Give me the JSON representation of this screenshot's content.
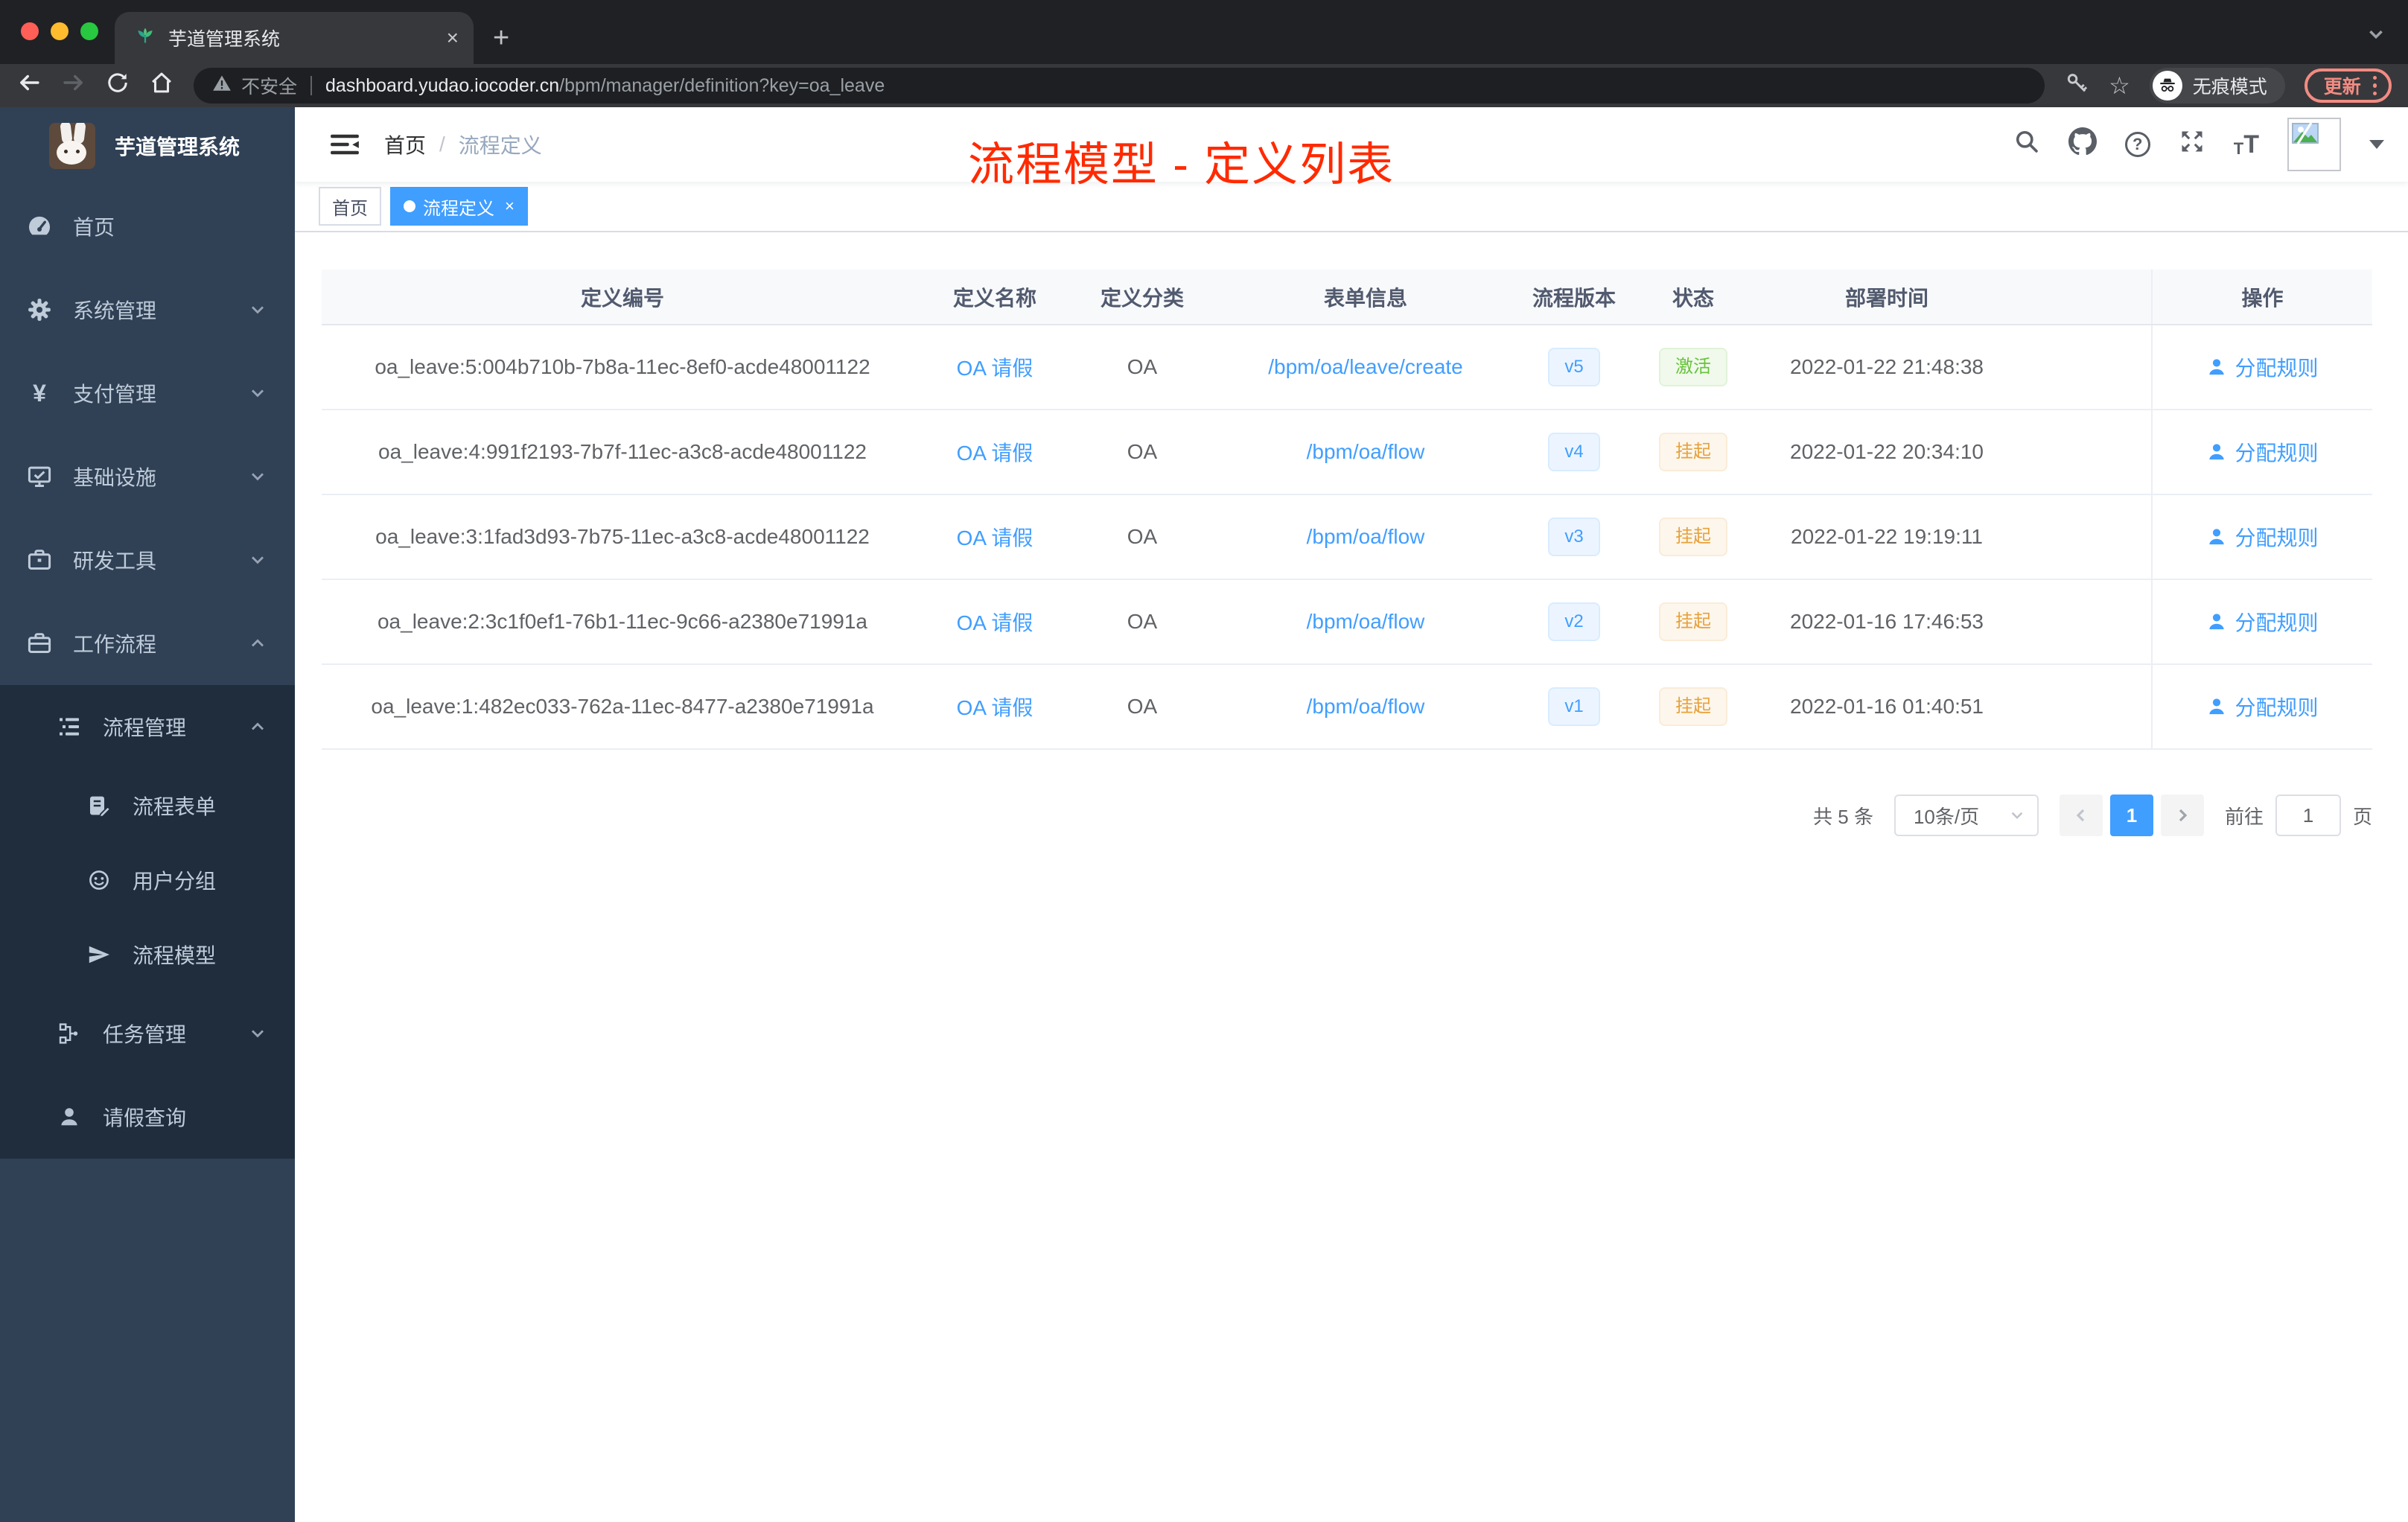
{
  "colors": {
    "accent": "#409eff",
    "success": "#67c23a",
    "warning": "#e6a23c",
    "annotation_red": "#ff2a00",
    "sidebar_bg": "#304156",
    "submenu_bg": "#1f2d3d",
    "active_tag_bg": "#409eff"
  },
  "glyphs": {
    "close": "×",
    "plus": "+",
    "star_outline": "☆",
    "question": "?",
    "yen": "¥",
    "t_small": "T",
    "t_large": "T"
  },
  "browser": {
    "tab_title": "芋道管理系统",
    "security_label": "不安全",
    "url_domain": "dashboard.yudao.iocoder.cn",
    "url_path": "/bpm/manager/definition?key=oa_leave",
    "incognito_label": "无痕模式",
    "update_label": "更新"
  },
  "sidebar": {
    "app_title": "芋道管理系统",
    "items": [
      {
        "label": "首页",
        "icon": "dashboard-icon"
      },
      {
        "label": "系统管理",
        "icon": "gear-icon",
        "expand": "down"
      },
      {
        "label": "支付管理",
        "icon": "yen-icon",
        "expand": "down"
      },
      {
        "label": "基础设施",
        "icon": "monitor-icon",
        "expand": "down"
      },
      {
        "label": "研发工具",
        "icon": "toolbox-icon",
        "expand": "down"
      },
      {
        "label": "工作流程",
        "icon": "briefcase-icon",
        "expand": "up"
      },
      {
        "label": "流程管理",
        "icon": "tree-list-icon",
        "expand": "up"
      },
      {
        "label": "流程表单",
        "icon": "form-icon"
      },
      {
        "label": "用户分组",
        "icon": "robot-icon"
      },
      {
        "label": "流程模型",
        "icon": "send-icon"
      },
      {
        "label": "任务管理",
        "icon": "flow-icon",
        "expand": "down"
      },
      {
        "label": "请假查询",
        "icon": "user-icon"
      }
    ]
  },
  "navbar": {
    "breadcrumb_home": "首页",
    "breadcrumb_separator": "/",
    "breadcrumb_current": "流程定义"
  },
  "tags_view": {
    "tags": [
      {
        "label": "首页",
        "active": false
      },
      {
        "label": "流程定义",
        "active": true
      }
    ]
  },
  "annotation": {
    "title": "流程模型 - 定义列表"
  },
  "table": {
    "columns": [
      "定义编号",
      "定义名称",
      "定义分类",
      "表单信息",
      "流程版本",
      "状态",
      "部署时间",
      "操作"
    ],
    "rows": [
      {
        "id": "oa_leave:5:004b710b-7b8a-11ec-8ef0-acde48001122",
        "name": "OA 请假",
        "category": "OA",
        "form": "/bpm/oa/leave/create",
        "version": "v5",
        "status": "激活",
        "status_type": "success",
        "deployed_at": "2022-01-22 21:48:38",
        "action": "分配规则"
      },
      {
        "id": "oa_leave:4:991f2193-7b7f-11ec-a3c8-acde48001122",
        "name": "OA 请假",
        "category": "OA",
        "form": "/bpm/oa/flow",
        "version": "v4",
        "status": "挂起",
        "status_type": "warning",
        "deployed_at": "2022-01-22 20:34:10",
        "action": "分配规则"
      },
      {
        "id": "oa_leave:3:1fad3d93-7b75-11ec-a3c8-acde48001122",
        "name": "OA 请假",
        "category": "OA",
        "form": "/bpm/oa/flow",
        "version": "v3",
        "status": "挂起",
        "status_type": "warning",
        "deployed_at": "2022-01-22 19:19:11",
        "action": "分配规则"
      },
      {
        "id": "oa_leave:2:3c1f0ef1-76b1-11ec-9c66-a2380e71991a",
        "name": "OA 请假",
        "category": "OA",
        "form": "/bpm/oa/flow",
        "version": "v2",
        "status": "挂起",
        "status_type": "warning",
        "deployed_at": "2022-01-16 17:46:53",
        "action": "分配规则"
      },
      {
        "id": "oa_leave:1:482ec033-762a-11ec-8477-a2380e71991a",
        "name": "OA 请假",
        "category": "OA",
        "form": "/bpm/oa/flow",
        "version": "v1",
        "status": "挂起",
        "status_type": "warning",
        "deployed_at": "2022-01-16 01:40:51",
        "action": "分配规则"
      }
    ]
  },
  "pagination": {
    "total": "共 5 条",
    "page_size": "10条/页",
    "current_page": "1",
    "goto_label": "前往",
    "goto_value": "1",
    "page_unit": "页"
  }
}
